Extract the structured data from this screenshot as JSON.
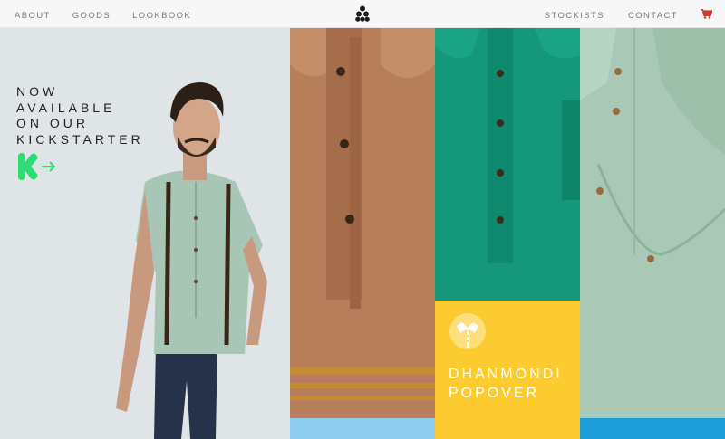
{
  "nav": {
    "left": [
      "ABOUT",
      "GOODS",
      "LOOKBOOK"
    ],
    "right": [
      "STOCKISTS",
      "CONTACT"
    ]
  },
  "icons": {
    "logo": "triangle-dots-logo-icon",
    "cart": "shopping-cart-icon",
    "kickstarter": "kickstarter-logo-icon",
    "collar": "shirt-collar-icon"
  },
  "hero": {
    "lines": [
      "NOW",
      "AVAILABLE",
      "ON OUR",
      "KICKSTARTER"
    ]
  },
  "product": {
    "name_lines": [
      "DHANMONDI",
      "POPOVER"
    ]
  },
  "colors": {
    "accent_red": "#e0322f",
    "kickstarter_green": "#2bde73",
    "yellow": "#fbcb2f",
    "light_blue": "#8ecdf0",
    "blue": "#1b9ed9",
    "rust": "#b67e5b",
    "teal": "#14977a",
    "mint": "#a9c9b6"
  }
}
